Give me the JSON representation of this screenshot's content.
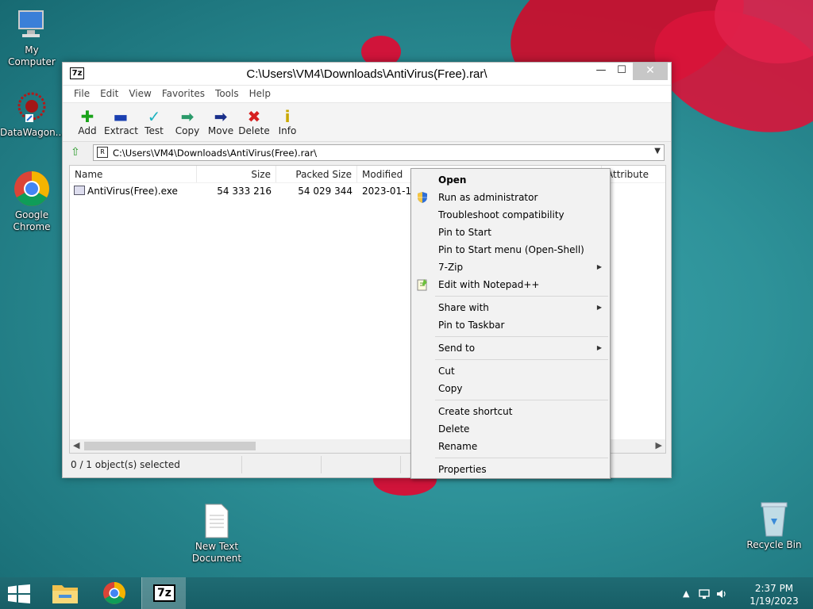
{
  "desktop": {
    "icons": {
      "my_computer": "My Computer",
      "datawagon": "DataWagon...",
      "chrome_line1": "Google",
      "chrome_line2": "Chrome",
      "new_text_line1": "New Text",
      "new_text_line2": "Document",
      "recycle_bin": "Recycle Bin"
    }
  },
  "window": {
    "app_icon": "7z",
    "title": "C:\\Users\\VM4\\Downloads\\AntiVirus(Free).rar\\",
    "controls": {
      "minimize": "—",
      "maximize": "☐",
      "close": "✕"
    },
    "menu": [
      "File",
      "Edit",
      "View",
      "Favorites",
      "Tools",
      "Help"
    ],
    "toolbar": [
      {
        "label": "Add",
        "icon": "add-icon",
        "glyph": "✚",
        "color": "#1aa31a"
      },
      {
        "label": "Extract",
        "icon": "extract-icon",
        "glyph": "▬",
        "color": "#1a3fb0"
      },
      {
        "label": "Test",
        "icon": "test-icon",
        "glyph": "✓",
        "color": "#1fb3c0"
      },
      {
        "label": "Copy",
        "icon": "copy-icon",
        "glyph": "➡",
        "color": "#2a9a6a"
      },
      {
        "label": "Move",
        "icon": "move-icon",
        "glyph": "➡",
        "color": "#1a2f8a"
      },
      {
        "label": "Delete",
        "icon": "delete-icon",
        "glyph": "✖",
        "color": "#d62020"
      },
      {
        "label": "Info",
        "icon": "info-icon",
        "glyph": "i",
        "color": "#c9a800"
      }
    ],
    "address": "C:\\Users\\VM4\\Downloads\\AntiVirus(Free).rar\\",
    "columns": [
      "Name",
      "Size",
      "Packed Size",
      "Modified",
      "Attribute"
    ],
    "rows": [
      {
        "name": "AntiVirus(Free).exe",
        "size": "54 333 216",
        "packed": "54 029 344",
        "modified": "2023-01-19"
      }
    ],
    "status": "0 / 1 object(s) selected"
  },
  "context_menu": {
    "items": [
      {
        "label": "Open",
        "bold": true
      },
      {
        "label": "Run as administrator",
        "icon": "shield-icon"
      },
      {
        "label": "Troubleshoot compatibility"
      },
      {
        "label": "Pin to Start"
      },
      {
        "label": "Pin to Start menu (Open-Shell)"
      },
      {
        "label": "7-Zip",
        "submenu": true
      },
      {
        "label": "Edit with Notepad++",
        "icon": "notepad-icon"
      },
      {
        "sep": true
      },
      {
        "label": "Share with",
        "submenu": true
      },
      {
        "label": "Pin to Taskbar"
      },
      {
        "sep": true
      },
      {
        "label": "Send to",
        "submenu": true
      },
      {
        "sep": true
      },
      {
        "label": "Cut"
      },
      {
        "label": "Copy"
      },
      {
        "sep": true
      },
      {
        "label": "Create shortcut"
      },
      {
        "label": "Delete"
      },
      {
        "label": "Rename"
      },
      {
        "sep": true
      },
      {
        "label": "Properties"
      }
    ]
  },
  "taskbar": {
    "tb_7z_label": "7z",
    "clock_time": "2:37 PM",
    "clock_date": "1/19/2023"
  }
}
